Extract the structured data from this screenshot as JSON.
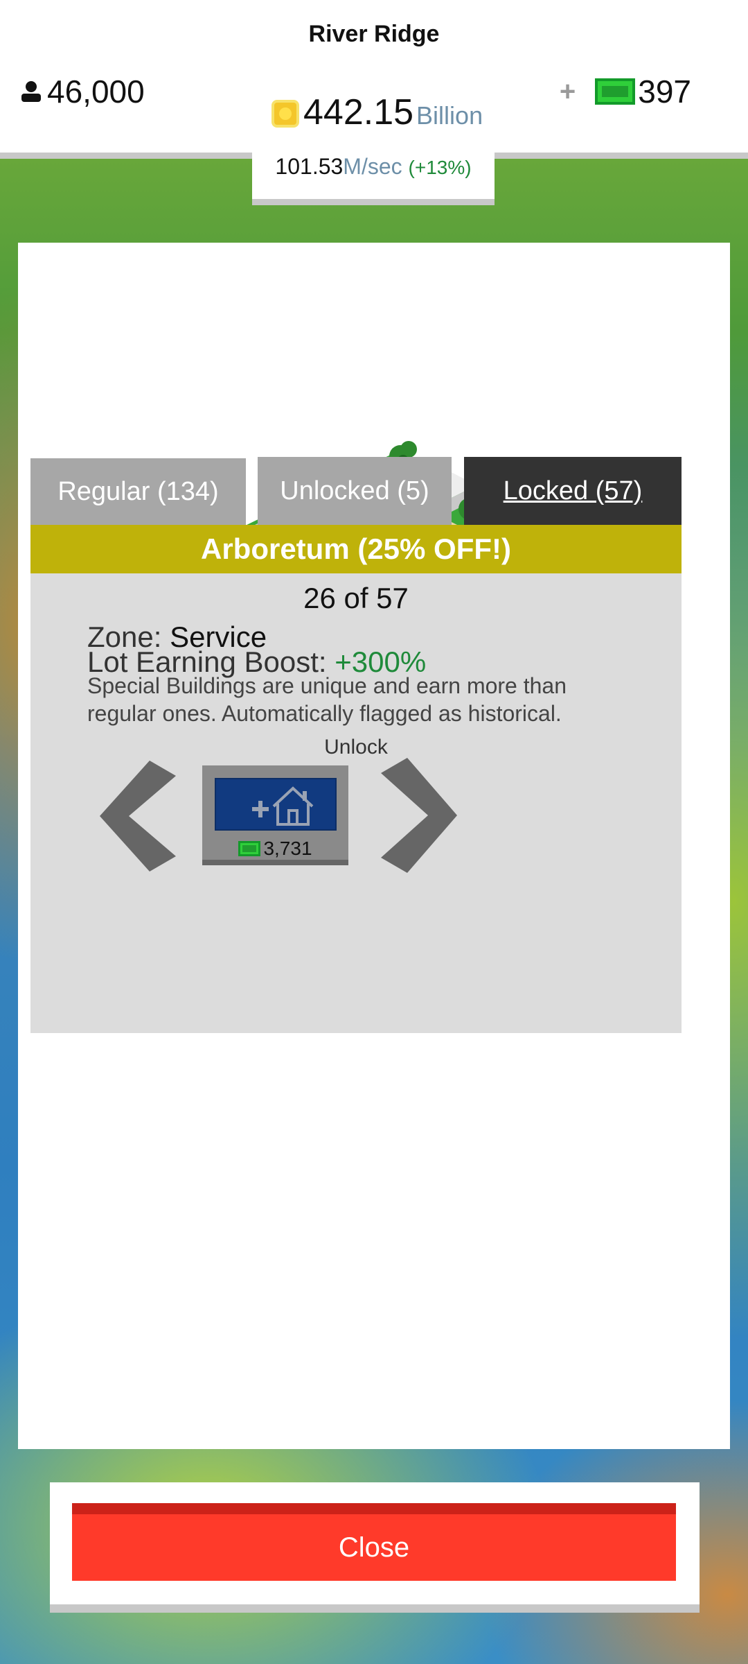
{
  "header": {
    "city_name": "River Ridge",
    "population": "46,000",
    "money": "442.15",
    "money_unit": "Billion",
    "rate_value": "101.53",
    "rate_unit": "M/sec",
    "rate_pct": "(+13%)",
    "gems_plus": "+",
    "gems": "397"
  },
  "tabs": {
    "regular": "Regular (134)",
    "unlocked": "Unlocked (5)",
    "locked": "Locked (57)"
  },
  "building": {
    "title": "Arboretum (25% OFF!)",
    "counter": "26 of 57",
    "zone_label": "Zone:",
    "zone_value": "Service",
    "boost_label": "Lot Earning Boost:",
    "boost_value": "+300%",
    "description": "Special Buildings are unique and earn more than regular ones. Automatically flagged as historical."
  },
  "unlock": {
    "label": "Unlock",
    "cost": "3,731"
  },
  "close_label": "Close",
  "colors": {
    "title_bar": "#bfb20a",
    "tab_active": "#333333",
    "tab_inactive": "#a7a7a7",
    "close": "#ff3a2a",
    "unlock_button": "#113a80",
    "boost_green": "#1f8a3a"
  },
  "icons": [
    "person-icon",
    "coin-icon",
    "gem-icon",
    "plus-icon",
    "house-icon",
    "chevron-left-icon",
    "chevron-right-icon"
  ]
}
